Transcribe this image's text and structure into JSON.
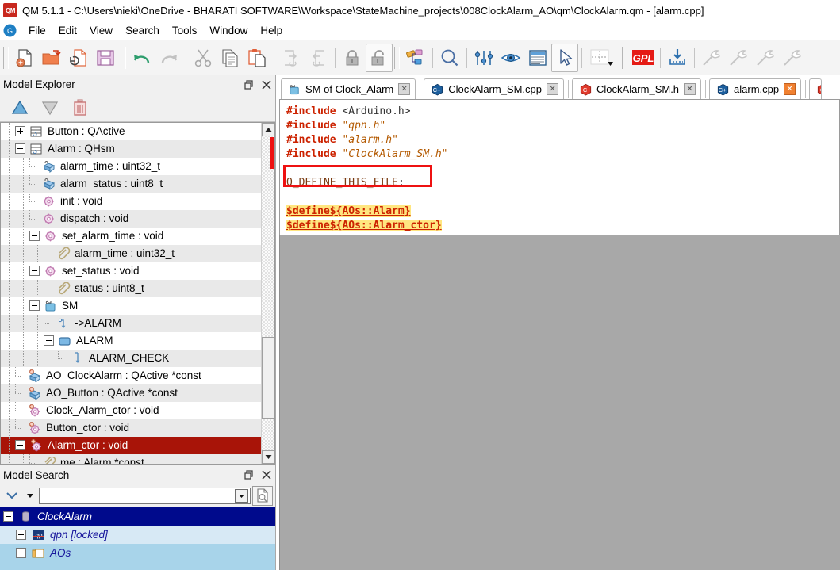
{
  "window": {
    "title": "QM 5.1.1 - C:\\Users\\nieki\\OneDrive - BHARATI SOFTWARE\\Workspace\\StateMachine_projects\\008ClockAlarm_AO\\qm\\ClockAlarm.qm - [alarm.cpp]",
    "app_icon": "qm-logo-icon"
  },
  "menubar": {
    "logo_icon": "qm-round-icon",
    "items": [
      {
        "label": "File"
      },
      {
        "label": "Edit"
      },
      {
        "label": "View"
      },
      {
        "label": "Search"
      },
      {
        "label": "Tools"
      },
      {
        "label": "Window"
      },
      {
        "label": "Help"
      }
    ]
  },
  "toolbar": {
    "groups": [
      {
        "buttons": [
          {
            "name": "new-document-button",
            "icon": "new-file-icon",
            "enabled": true
          },
          {
            "name": "open-document-button",
            "icon": "open-folder-icon",
            "enabled": true
          },
          {
            "name": "reload-document-button",
            "icon": "refresh-file-icon",
            "enabled": true
          },
          {
            "name": "save-document-button",
            "icon": "floppy-save-icon",
            "enabled": true
          }
        ]
      },
      {
        "buttons": [
          {
            "name": "undo-button",
            "icon": "undo-arrow-icon",
            "enabled": true
          },
          {
            "name": "redo-button",
            "icon": "redo-arrow-icon",
            "enabled": false
          },
          {
            "name": "cut-button",
            "icon": "scissors-icon",
            "enabled": false
          },
          {
            "name": "copy-button",
            "icon": "copy-pages-icon",
            "enabled": true
          },
          {
            "name": "paste-button",
            "icon": "clipboard-paste-icon",
            "enabled": true
          },
          {
            "name": "export-button",
            "icon": "arrow-out-box-icon",
            "enabled": false
          },
          {
            "name": "import-button",
            "icon": "arrow-in-box-icon",
            "enabled": false
          },
          {
            "name": "lock-button",
            "icon": "padlock-closed-icon",
            "enabled": false
          },
          {
            "name": "unlock-button",
            "icon": "padlock-open-icon",
            "enabled": false
          }
        ]
      },
      {
        "buttons": [
          {
            "name": "model-properties-button",
            "icon": "shapes-link-icon",
            "enabled": true
          },
          {
            "name": "find-button",
            "icon": "magnifier-icon",
            "enabled": true
          },
          {
            "name": "preferences-button",
            "icon": "sliders-icon",
            "enabled": true
          },
          {
            "name": "show-view-button",
            "icon": "eye-icon",
            "enabled": true
          },
          {
            "name": "show-list-button",
            "icon": "list-window-icon",
            "enabled": true
          },
          {
            "name": "select-pointer-button",
            "icon": "cursor-arrow-icon",
            "enabled": true
          },
          {
            "name": "grid-dropdown-button",
            "icon": "grid-dropdown-icon",
            "enabled": true
          }
        ]
      },
      {
        "buttons": [
          {
            "name": "gpl-license-button",
            "icon": "gpl-badge-icon",
            "enabled": true
          },
          {
            "name": "generate-code-button",
            "icon": "download-tray-icon",
            "enabled": true
          },
          {
            "name": "build-1-button",
            "icon": "hammer-icon",
            "enabled": false
          },
          {
            "name": "build-2-button",
            "icon": "hammer-icon",
            "enabled": false
          },
          {
            "name": "build-3-button",
            "icon": "hammer-icon",
            "enabled": false
          },
          {
            "name": "build-4-button",
            "icon": "hammer-icon",
            "enabled": false
          }
        ]
      }
    ]
  },
  "model_explorer": {
    "title": "Model Explorer",
    "float_icon": "restore-window-icon",
    "close_icon": "close-icon",
    "toolbar": [
      {
        "name": "move-up-button",
        "icon": "triangle-up-icon",
        "enabled": true
      },
      {
        "name": "move-down-button",
        "icon": "triangle-down-icon",
        "enabled": false
      },
      {
        "name": "delete-button",
        "icon": "trash-icon",
        "enabled": true
      }
    ],
    "tree": [
      {
        "label": "Button : QActive",
        "depth": 1,
        "exp": "plus",
        "icon": "class-icon",
        "alt": false,
        "sel": false
      },
      {
        "label": "Alarm : QHsm",
        "depth": 1,
        "exp": "minus",
        "icon": "class-icon",
        "alt": true,
        "sel": false
      },
      {
        "label": "alarm_time : uint32_t",
        "depth": 2,
        "exp": "leaf",
        "icon": "attribute-icon",
        "alt": false,
        "sel": false
      },
      {
        "label": "alarm_status : uint8_t",
        "depth": 2,
        "exp": "leaf",
        "icon": "attribute-icon",
        "alt": true,
        "sel": false
      },
      {
        "label": "init : void",
        "depth": 2,
        "exp": "leaf",
        "icon": "operation-icon",
        "alt": false,
        "sel": false
      },
      {
        "label": "dispatch : void",
        "depth": 2,
        "exp": "leaf",
        "icon": "operation-icon",
        "alt": true,
        "sel": false
      },
      {
        "label": "set_alarm_time : void",
        "depth": 2,
        "exp": "minus",
        "icon": "operation-icon",
        "alt": false,
        "sel": false
      },
      {
        "label": "alarm_time : uint32_t",
        "depth": 3,
        "exp": "leaf",
        "icon": "parameter-icon",
        "alt": true,
        "sel": false
      },
      {
        "label": "set_status : void",
        "depth": 2,
        "exp": "minus",
        "icon": "operation-icon",
        "alt": false,
        "sel": false
      },
      {
        "label": "status : uint8_t",
        "depth": 3,
        "exp": "leaf",
        "icon": "parameter-icon",
        "alt": true,
        "sel": false
      },
      {
        "label": "SM",
        "depth": 2,
        "exp": "minus",
        "icon": "statemachine-icon",
        "alt": false,
        "sel": false
      },
      {
        "label": "->ALARM",
        "depth": 3,
        "exp": "leaf",
        "icon": "init-transition-icon",
        "alt": true,
        "sel": false
      },
      {
        "label": "ALARM",
        "depth": 3,
        "exp": "minus",
        "icon": "state-icon",
        "alt": false,
        "sel": false
      },
      {
        "label": "ALARM_CHECK",
        "depth": 4,
        "exp": "leaf",
        "icon": "transition-icon",
        "alt": true,
        "sel": false
      },
      {
        "label": "AO_ClockAlarm : QActive *const",
        "depth": 1,
        "exp": "leaf",
        "icon": "global-attribute-icon",
        "alt": false,
        "sel": false
      },
      {
        "label": "AO_Button : QActive *const",
        "depth": 1,
        "exp": "leaf",
        "icon": "global-attribute-icon",
        "alt": true,
        "sel": false
      },
      {
        "label": "Clock_Alarm_ctor : void",
        "depth": 1,
        "exp": "leaf",
        "icon": "global-operation-icon",
        "alt": false,
        "sel": false
      },
      {
        "label": "Button_ctor : void",
        "depth": 1,
        "exp": "leaf",
        "icon": "global-operation-icon",
        "alt": true,
        "sel": false
      },
      {
        "label": "Alarm_ctor : void",
        "depth": 1,
        "exp": "minus",
        "icon": "global-operation-icon",
        "alt": false,
        "sel": true
      },
      {
        "label": "me : Alarm *const",
        "depth": 2,
        "exp": "leaf",
        "icon": "parameter-icon",
        "alt": true,
        "sel": false
      }
    ],
    "scrollbar": {
      "up_icon": "scroll-up-icon",
      "down_icon": "scroll-down-icon",
      "marker_color": "#ee1111"
    }
  },
  "model_search": {
    "title": "Model Search",
    "float_icon": "restore-window-icon",
    "close_icon": "close-icon",
    "collapse_icon": "chevron-down-icon",
    "dropdown_icon": "caret-down-icon",
    "input_value": "",
    "input_placeholder": "",
    "search_icon": "document-search-icon",
    "results": [
      {
        "label": "ClockAlarm",
        "depth": 0,
        "exp": "minus",
        "icon": "model-icon",
        "sel": true,
        "light": false
      },
      {
        "label": "qpn [locked]",
        "depth": 1,
        "exp": "plus",
        "icon": "package-locked-icon",
        "sel": false,
        "light": true
      },
      {
        "label": "AOs",
        "depth": 1,
        "exp": "plus",
        "icon": "folder-package-icon",
        "sel": false,
        "light": false
      }
    ]
  },
  "editor": {
    "tabs": [
      {
        "label": "SM of Clock_Alarm",
        "icon": "statemachine-icon",
        "active": false,
        "close_icon": "close-icon"
      },
      {
        "label": "ClockAlarm_SM.cpp",
        "icon": "cpp-file-icon",
        "active": false,
        "close_icon": "close-icon"
      },
      {
        "label": "ClockAlarm_SM.h",
        "icon": "header-file-icon",
        "active": false,
        "close_icon": "close-icon"
      },
      {
        "label": "alarm.cpp",
        "icon": "cpp-file-icon",
        "active": true,
        "close_icon": "close-icon"
      }
    ],
    "code_lines": [
      {
        "segments": [
          {
            "t": "#include",
            "c": "kw"
          },
          {
            "t": " ",
            "c": ""
          },
          {
            "t": "<Arduino.h>",
            "c": "ang"
          }
        ]
      },
      {
        "segments": [
          {
            "t": "#include",
            "c": "kw"
          },
          {
            "t": " ",
            "c": ""
          },
          {
            "t": "\"qpn.h\"",
            "c": "str"
          }
        ]
      },
      {
        "segments": [
          {
            "t": "#include",
            "c": "kw"
          },
          {
            "t": " ",
            "c": ""
          },
          {
            "t": "\"alarm.h\"",
            "c": "str"
          }
        ]
      },
      {
        "segments": [
          {
            "t": "#include",
            "c": "kw"
          },
          {
            "t": " ",
            "c": ""
          },
          {
            "t": "\"ClockAlarm_SM.h\"",
            "c": "str"
          }
        ]
      },
      {
        "segments": []
      },
      {
        "segments": [
          {
            "t": "Q_DEFINE_THIS_FILE",
            "c": "qdef"
          },
          {
            "t": ";",
            "c": ""
          }
        ]
      },
      {
        "segments": []
      },
      {
        "segments": [
          {
            "t": "$define${AOs::Alarm}",
            "c": "macro"
          }
        ]
      },
      {
        "segments": [
          {
            "t": "$define${AOs::Alarm_ctor}",
            "c": "macro"
          }
        ]
      }
    ],
    "highlight_box_color": "#ee1111"
  }
}
